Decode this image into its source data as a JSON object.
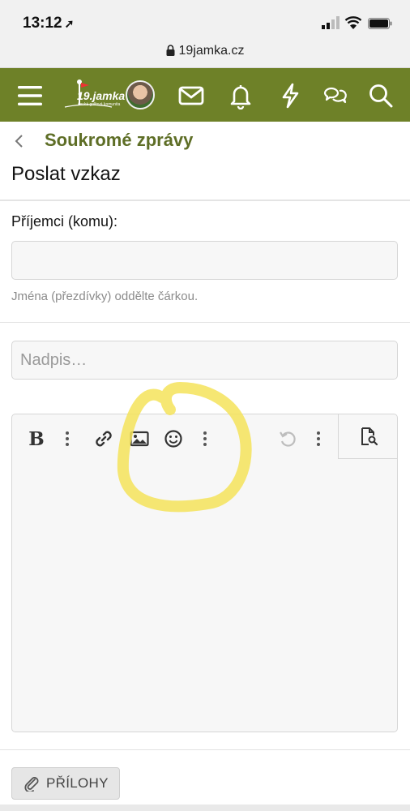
{
  "status_bar": {
    "time": "13:12"
  },
  "browser": {
    "url": "19jamka.cz"
  },
  "header": {
    "logo_text": "19.jamka",
    "logo_subtext": "česká golfová komunita",
    "icons": [
      "menu-icon",
      "avatar",
      "mail-icon",
      "bell-icon",
      "bolt-icon",
      "chat-icon",
      "search-icon"
    ],
    "brand_color": "#6e8128"
  },
  "breadcrumb": {
    "label": "Soukromé zprávy"
  },
  "page": {
    "title": "Poslat vzkaz"
  },
  "form": {
    "recipients_label": "Příjemci (komu):",
    "recipients_value": "",
    "recipients_hint": "Jména (přezdívky) oddělte čárkou.",
    "subject_placeholder": "Nadpis…",
    "subject_value": ""
  },
  "editor": {
    "toolbar": [
      "bold-icon",
      "more-icon",
      "link-icon",
      "image-icon",
      "emoji-icon",
      "more-icon",
      "undo-icon",
      "more-icon",
      "preview-icon"
    ],
    "content": ""
  },
  "attachments": {
    "label": "PŘÍLOHY"
  },
  "highlight_color": "#f5e35a"
}
